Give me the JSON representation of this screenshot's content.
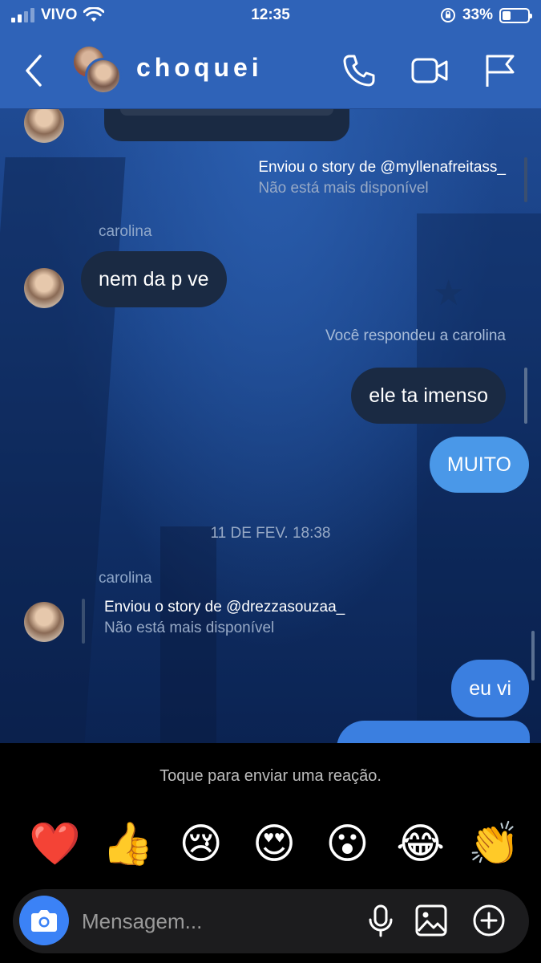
{
  "status": {
    "carrier": "VIVO",
    "time": "12:35",
    "battery": "33%",
    "battery_level": 0.33
  },
  "header": {
    "title": "choquei"
  },
  "chat": {
    "story_1": {
      "line1": "Enviou o story de @myllenafreitass_",
      "line2": "Não está mais disponível"
    },
    "sender_1": "carolina",
    "msg_1": "nem da p ve",
    "reply_note": "Você respondeu a carolina",
    "msg_2": "ele ta imenso",
    "msg_3": "MUITO",
    "date_separator": "11 DE FEV. 18:38",
    "sender_2": "carolina",
    "story_2": {
      "line1": "Enviou o story de @drezzasouzaa_",
      "line2": "Não está mais disponível"
    },
    "msg_4": "eu vi"
  },
  "reactions": {
    "hint": "Toque para enviar uma reação.",
    "items": [
      "❤️",
      "👍",
      "😢",
      "😍",
      "😮",
      "😂",
      "👏"
    ]
  },
  "composer": {
    "placeholder": "Mensagem..."
  },
  "colors": {
    "header_bg": "#2f63b8",
    "bubble_dark": "#1a2a43",
    "bubble_blue": "#4a98e8",
    "camera_button": "#3b82f6"
  }
}
